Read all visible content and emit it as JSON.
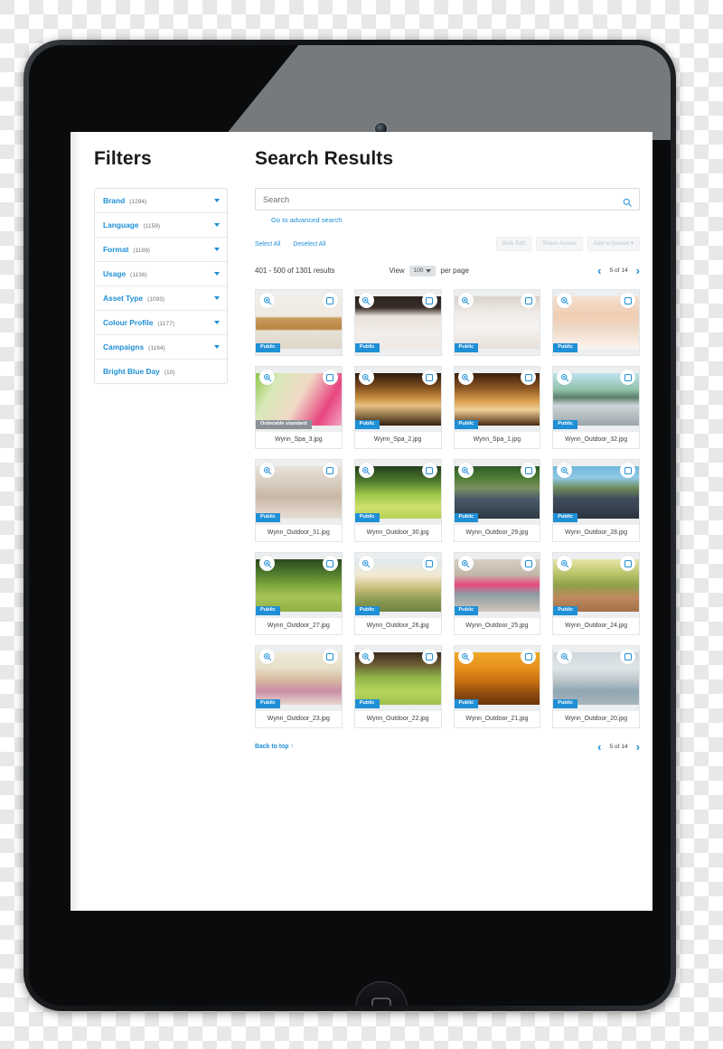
{
  "sidebar": {
    "title": "Filters",
    "filters": [
      {
        "label": "Brand",
        "count": "(1294)",
        "expandable": true
      },
      {
        "label": "Language",
        "count": "(1159)",
        "expandable": true
      },
      {
        "label": "Format",
        "count": "(1189)",
        "expandable": true
      },
      {
        "label": "Usage",
        "count": "(1136)",
        "expandable": true
      },
      {
        "label": "Asset Type",
        "count": "(1093)",
        "expandable": true
      },
      {
        "label": "Colour Profile",
        "count": "(1177)",
        "expandable": true
      },
      {
        "label": "Campaigns",
        "count": "(1164)",
        "expandable": true
      },
      {
        "label": "Bright Blue Day",
        "count": "(10)",
        "expandable": false
      }
    ]
  },
  "main": {
    "title": "Search Results",
    "search": {
      "value": "",
      "placeholder": "Search",
      "icon": "search-icon",
      "advanced_link": "Go to advanced search"
    },
    "selection": {
      "select_all": "Select All",
      "deselect_all": "Deselect All"
    },
    "actions": [
      {
        "label": "Bulk Edit",
        "disabled": true
      },
      {
        "label": "Share Assets",
        "disabled": true
      },
      {
        "label": "Add to basket ▾",
        "disabled": true
      }
    ],
    "results": {
      "count_text": "401 - 500 of 1301 results",
      "view_label": "View",
      "view_value": "100",
      "per_page_label": "per page"
    },
    "pagination_top": {
      "prev": "‹",
      "page_text": "5 of 14",
      "next": "›"
    },
    "pagination_bottom": {
      "prev": "‹",
      "page_text": "5 of 14",
      "next": "›"
    },
    "back_to_top": "Back to top ↑",
    "badges": {
      "public": "Public",
      "orderable": "Orderable standard"
    },
    "assets": [
      {
        "name": "",
        "badge": "Public",
        "badge_type": "public",
        "kind": "spa-lobby"
      },
      {
        "name": "",
        "badge": "Public",
        "badge_type": "public",
        "kind": "spa-friends-robes"
      },
      {
        "name": "",
        "badge": "Public",
        "badge_type": "public",
        "kind": "spa-lounging"
      },
      {
        "name": "",
        "badge": "Public",
        "badge_type": "public",
        "kind": "spa-face-masks"
      },
      {
        "name": "Wynn_Spa_3.jpg",
        "badge": "Orderable standard",
        "badge_type": "orderable",
        "kind": "spa-circle-cucumber"
      },
      {
        "name": "Wynn_Spa_2.jpg",
        "badge": "Public",
        "badge_type": "public",
        "kind": "spa-sauna"
      },
      {
        "name": "Wynn_Spa_1.jpg",
        "badge": "Public",
        "badge_type": "public",
        "kind": "spa-relax-room"
      },
      {
        "name": "Wynn_Outdoor_32.jpg",
        "badge": "Public",
        "badge_type": "public",
        "kind": "outdoor-cyclist"
      },
      {
        "name": "Wynn_Outdoor_31.jpg",
        "badge": "Public",
        "badge_type": "public",
        "kind": "outdoor-stretch-shoe"
      },
      {
        "name": "Wynn_Outdoor_30.jpg",
        "badge": "Public",
        "badge_type": "public",
        "kind": "outdoor-park-lawn"
      },
      {
        "name": "Wynn_Outdoor_29.jpg",
        "badge": "Public",
        "badge_type": "public",
        "kind": "outdoor-crowd-class"
      },
      {
        "name": "Wynn_Outdoor_28.jpg",
        "badge": "Public",
        "badge_type": "public",
        "kind": "outdoor-crowd-hands"
      },
      {
        "name": "Wynn_Outdoor_27.jpg",
        "badge": "Public",
        "badge_type": "public",
        "kind": "outdoor-group-field"
      },
      {
        "name": "Wynn_Outdoor_26.jpg",
        "badge": "Public",
        "badge_type": "public",
        "kind": "outdoor-road-walk"
      },
      {
        "name": "Wynn_Outdoor_25.jpg",
        "badge": "Public",
        "badge_type": "public",
        "kind": "outdoor-mat-rest"
      },
      {
        "name": "Wynn_Outdoor_24.jpg",
        "badge": "Public",
        "badge_type": "public",
        "kind": "outdoor-runner-path"
      },
      {
        "name": "Wynn_Outdoor_23.jpg",
        "badge": "Public",
        "badge_type": "public",
        "kind": "outdoor-yoga-two"
      },
      {
        "name": "Wynn_Outdoor_22.jpg",
        "badge": "Public",
        "badge_type": "public",
        "kind": "outdoor-plank-group"
      },
      {
        "name": "Wynn_Outdoor_21.jpg",
        "badge": "Public",
        "badge_type": "public",
        "kind": "outdoor-autumn-shoes"
      },
      {
        "name": "Wynn_Outdoor_20.jpg",
        "badge": "Public",
        "badge_type": "public",
        "kind": "outdoor-rooftop-yoga"
      }
    ]
  },
  "colors": {
    "accent": "#1f8fd6",
    "badge_public": "#1f8fd6",
    "badge_orderable": "#8a9197",
    "text": "#3a4044",
    "border": "#e2e5e8"
  }
}
